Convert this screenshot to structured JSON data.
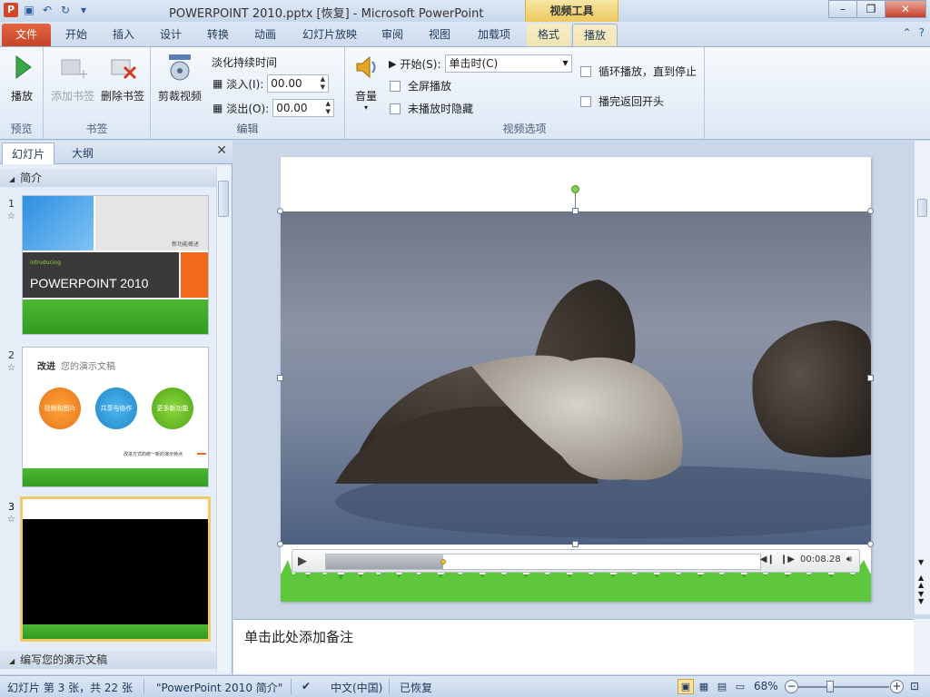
{
  "window": {
    "title": "POWERPOINT 2010.pptx [恢复] - Microsoft PowerPoint",
    "context_tool": "视频工具",
    "controls": [
      "–",
      "❐",
      "✕"
    ]
  },
  "tabs": {
    "file": "文件",
    "items": [
      "开始",
      "插入",
      "设计",
      "转换",
      "动画",
      "幻灯片放映",
      "审阅",
      "视图",
      "加载项",
      "格式",
      "播放"
    ],
    "active": "播放"
  },
  "ribbon": {
    "groups": {
      "preview": {
        "label": "预览",
        "play": "播放"
      },
      "bookmarks": {
        "label": "书签",
        "add": "添加书签",
        "remove": "删除书签"
      },
      "edit": {
        "label": "编辑",
        "trim": "剪裁视频",
        "fade_title": "淡化持续时间",
        "fade_in_label": "淡入(I):",
        "fade_in_value": "00.00",
        "fade_out_label": "淡出(O):",
        "fade_out_value": "00.00"
      },
      "video_options": {
        "label": "视频选项",
        "volume": "音量",
        "start_label": "开始(S):",
        "start_value": "单击时(C)",
        "fullscreen": "全屏播放",
        "hide_not_playing": "未播放时隐藏",
        "loop": "循环播放，直到停止",
        "rewind": "播完返回开头"
      }
    }
  },
  "left_panel": {
    "tabs": [
      "幻灯片",
      "大纲"
    ],
    "close": "✕",
    "sections": [
      "简介",
      "编写您的演示文稿"
    ],
    "slides": [
      {
        "num": "1",
        "heading": "POWERPOINT 2010",
        "intro": "introducing",
        "small": "新功能概述"
      },
      {
        "num": "2",
        "heading_bold": "改进",
        "heading_rest": "您的演示文稿",
        "circles": [
          "视频和图片",
          "共享与协作",
          "更多新功能"
        ],
        "footer": "改进方式的统一新的演示特点"
      },
      {
        "num": "3"
      }
    ]
  },
  "video": {
    "time": "00:08.28",
    "progress": 0.27
  },
  "notes": {
    "placeholder": "单击此处添加备注"
  },
  "status": {
    "slide_info": "幻灯片 第 3 张，共 22 张",
    "theme": "\"PowerPoint 2010 简介\"",
    "language": "中文(中国)",
    "recovered": "已恢复",
    "zoom": "68%"
  }
}
